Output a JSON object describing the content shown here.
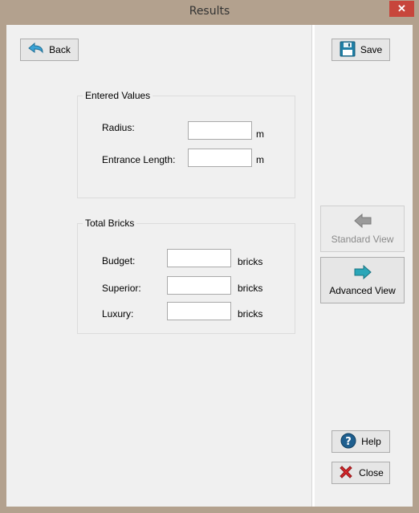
{
  "window": {
    "title": "Results",
    "close_glyph": "✕"
  },
  "buttons": {
    "back": "Back",
    "save": "Save",
    "standard_view": "Standard View",
    "advanced_view": "Advanced View",
    "help": "Help",
    "close": "Close"
  },
  "entered_values": {
    "heading": "Entered Values",
    "radius_label": "Radius:",
    "radius_value": "",
    "radius_unit": "m",
    "entrance_label": "Entrance Length:",
    "entrance_value": "",
    "entrance_unit": "m"
  },
  "total_bricks": {
    "heading": "Total Bricks",
    "budget_label": "Budget:",
    "budget_value": "",
    "superior_label": "Superior:",
    "superior_value": "",
    "luxury_label": "Luxury:",
    "luxury_value": "",
    "unit": "bricks"
  },
  "icons": {
    "back": "back-arrow-icon",
    "save": "floppy-disk-icon",
    "standard_view": "left-arrow-icon",
    "advanced_view": "right-arrow-icon",
    "help": "help-question-icon",
    "close": "red-x-icon"
  },
  "colors": {
    "frame": "#b3a18e",
    "close_button": "#c7463c",
    "advanced_arrow": "#2aa6b8",
    "back_arrow": "#3aa3d6"
  }
}
